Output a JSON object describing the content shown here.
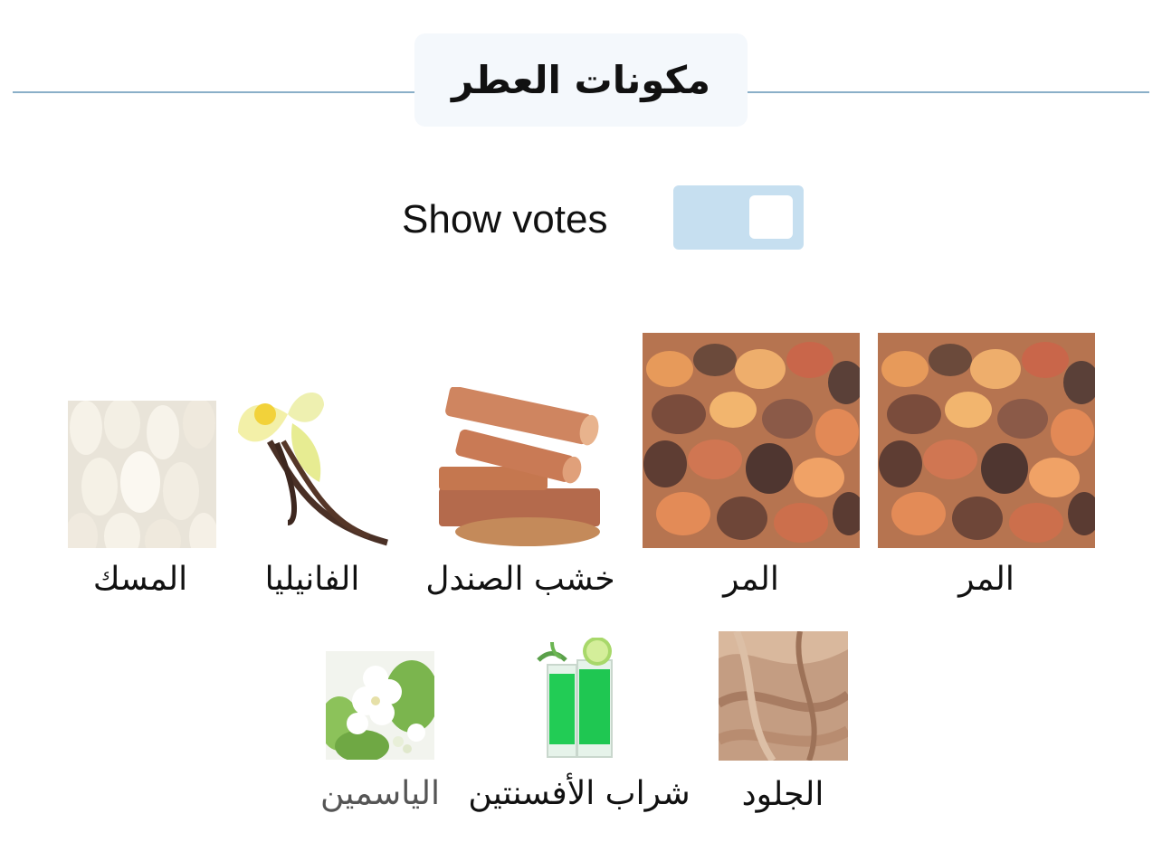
{
  "section": {
    "title": "مكونات العطر"
  },
  "votes": {
    "label": "Show votes",
    "toggle_on": false
  },
  "notes": [
    {
      "name": "المر",
      "image": "myrrh-resin-image"
    },
    {
      "name": "المر",
      "image": "myrrh-resin-image"
    },
    {
      "name": "خشب الصندل",
      "image": "sandalwood-image"
    },
    {
      "name": "الفانيليا",
      "image": "vanilla-image"
    },
    {
      "name": "المسك",
      "image": "musk-image"
    },
    {
      "name": "الجلود",
      "image": "leather-image"
    },
    {
      "name": "شراب الأفسنتين",
      "image": "absinthe-image"
    },
    {
      "name": "الياسمين",
      "image": "jasmine-image"
    }
  ]
}
